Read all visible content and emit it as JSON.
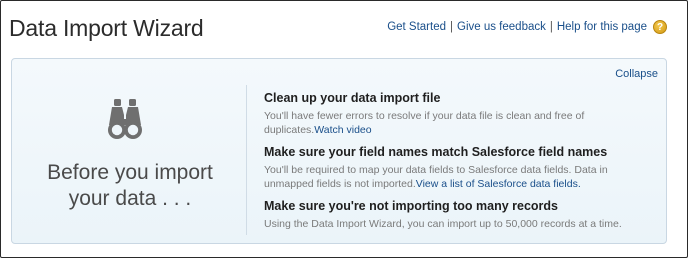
{
  "header": {
    "title": "Data Import Wizard",
    "links": {
      "get_started": "Get Started",
      "feedback": "Give us feedback",
      "help": "Help for this page",
      "separator": "|"
    },
    "help_icon_glyph": "?"
  },
  "panel": {
    "collapse_label": "Collapse",
    "icon": "binoculars-icon",
    "left_text_line1": "Before you import",
    "left_text_line2": "your data . . .",
    "tips": [
      {
        "title": "Clean up your data import file",
        "body": "You'll have fewer errors to resolve if your data file is clean and free of duplicates.",
        "link": "Watch video"
      },
      {
        "title": "Make sure your field names match Salesforce field names",
        "body": "You'll be required to map your data fields to Salesforce data fields. Data in unmapped fields is not imported.",
        "link": "View a list of Salesforce data fields."
      },
      {
        "title": "Make sure you're not importing too many records",
        "body": "Using the Data Import Wizard, you can import up to 50,000 records at a time."
      }
    ]
  },
  "colors": {
    "link": "#1a4f8a",
    "panel_bg": "#ebf4f9",
    "panel_border": "#c9d7e3",
    "help_icon": "#e0a91f"
  }
}
